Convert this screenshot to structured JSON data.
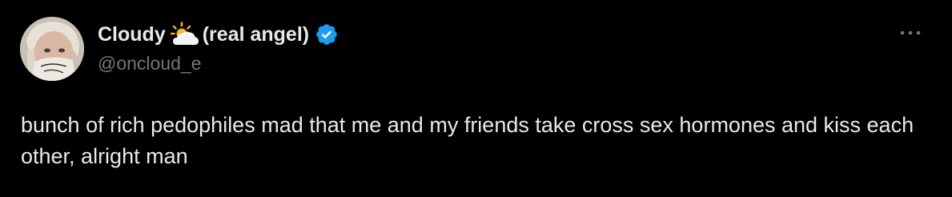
{
  "tweet": {
    "display_name_part1": "Cloudy",
    "display_name_part2": "(real angel)",
    "name_emoji": "sun-behind-cloud-icon",
    "verified": true,
    "handle": "@oncloud_e",
    "text": "bunch of rich pedophiles mad that me and my friends take cross sex hormones and kiss each other, alright man"
  },
  "colors": {
    "background": "#000000",
    "text_primary": "#e7e9ea",
    "text_secondary": "#71767b",
    "verified_badge": "#1d9bf0"
  },
  "icons": {
    "more": "more-options-icon",
    "verified": "verified-badge-icon"
  }
}
